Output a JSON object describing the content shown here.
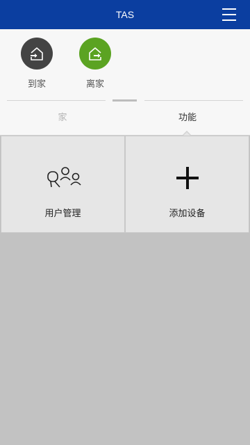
{
  "header": {
    "title": "TAS",
    "menu_icon": "hamburger-menu-icon",
    "color": "#0b3ea0"
  },
  "modes": {
    "home": {
      "label": "到家",
      "icon": "arrive-home-icon",
      "color": "#444444"
    },
    "away": {
      "label": "离家",
      "icon": "leave-home-icon",
      "color": "#5ba322"
    }
  },
  "tabs": {
    "home": "家",
    "functions": "功能",
    "active": "functions"
  },
  "functions": {
    "user_management": {
      "label": "用户管理",
      "icon": "users-icon"
    },
    "add_device": {
      "label": "添加设备",
      "icon": "plus-icon"
    }
  }
}
